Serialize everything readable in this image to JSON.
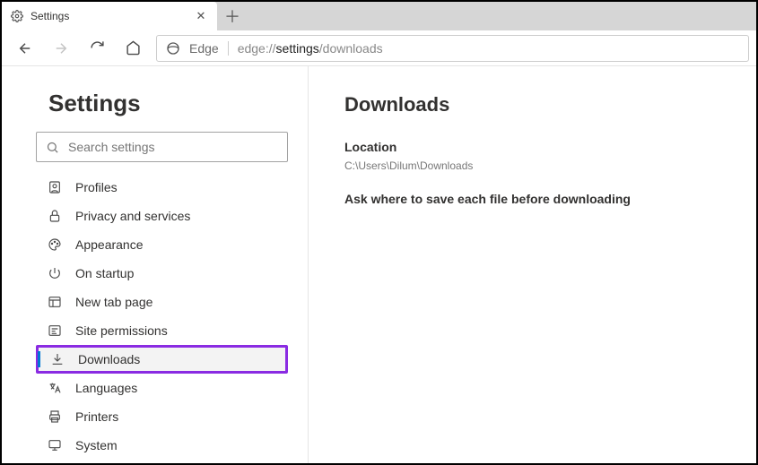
{
  "tab": {
    "title": "Settings"
  },
  "address": {
    "brand": "Edge",
    "url_prefix": "edge://",
    "url_bold": "settings",
    "url_suffix": "/downloads"
  },
  "sidebar": {
    "title": "Settings",
    "search_placeholder": "Search settings",
    "items": [
      {
        "label": "Profiles"
      },
      {
        "label": "Privacy and services"
      },
      {
        "label": "Appearance"
      },
      {
        "label": "On startup"
      },
      {
        "label": "New tab page"
      },
      {
        "label": "Site permissions"
      },
      {
        "label": "Downloads"
      },
      {
        "label": "Languages"
      },
      {
        "label": "Printers"
      },
      {
        "label": "System"
      }
    ]
  },
  "main": {
    "heading": "Downloads",
    "location_label": "Location",
    "location_value": "C:\\Users\\Dilum\\Downloads",
    "ask_label": "Ask where to save each file before downloading"
  }
}
